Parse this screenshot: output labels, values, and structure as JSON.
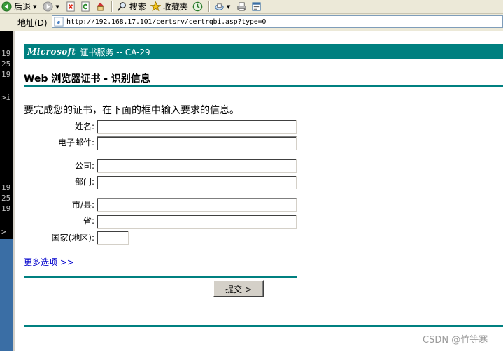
{
  "toolbar": {
    "back_label": "后退",
    "search_label": "搜索",
    "favorites_label": "收藏夹"
  },
  "addressbar": {
    "label": "地址(D)",
    "url": "http://192.168.17.101/certsrv/certrqbi.asp?type=0"
  },
  "console": {
    "lines": [
      "19",
      "25",
      "19",
      ">i",
      "19",
      "25",
      "19",
      ">"
    ]
  },
  "banner": {
    "brand": "Microsoft",
    "service": "证书服务 --  CA-29"
  },
  "page": {
    "heading": "Web 浏览器证书 - 识别信息",
    "intro": "要完成您的证书，在下面的框中输入要求的信息。",
    "more_options": "更多选项 >>",
    "submit_label": "提交 >"
  },
  "form": {
    "name_label": "姓名:",
    "name_value": "",
    "email_label": "电子邮件:",
    "email_value": "",
    "company_label": "公司:",
    "company_value": "",
    "department_label": "部门:",
    "department_value": "",
    "city_label": "市/县:",
    "city_value": "",
    "province_label": "省:",
    "province_value": "",
    "country_label": "国家(地区):",
    "country_value": ""
  },
  "watermark": "CSDN @竹等寒",
  "colors": {
    "teal": "#008080",
    "link": "#0000cc",
    "chrome": "#ece9d8"
  }
}
